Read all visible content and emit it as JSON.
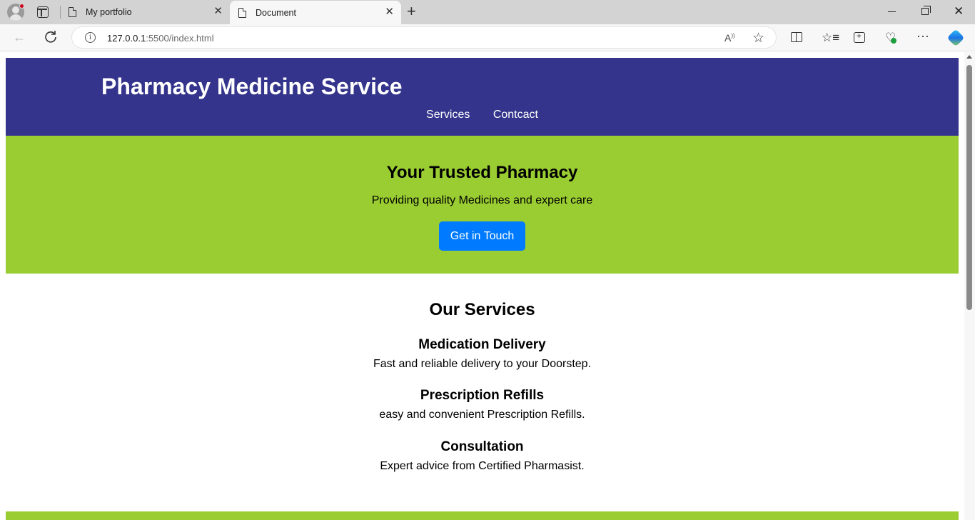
{
  "browser": {
    "tabs": [
      {
        "title": "My portfolio",
        "active": false
      },
      {
        "title": "Document",
        "active": true
      }
    ],
    "url_host": "127.0.0.1",
    "url_rest": ":5500/index.html",
    "icons": [
      "profile-icon",
      "tab-actions-icon",
      "document-icon",
      "close-icon",
      "new-tab-icon",
      "back-icon",
      "reload-icon",
      "info-icon",
      "read-aloud-icon",
      "favorite-star-icon",
      "split-screen-icon",
      "favorites-icon",
      "collections-icon",
      "browser-essentials-icon",
      "more-icon",
      "copilot-icon"
    ]
  },
  "site": {
    "title": "Pharmacy Medicine Service",
    "nav": [
      "Services",
      "Contcact"
    ],
    "hero": {
      "heading": "Your Trusted Pharmacy",
      "subtext": "Providing quality Medicines and expert care",
      "button": "Get in Touch"
    },
    "services": {
      "heading": "Our Services",
      "items": [
        {
          "title": "Medication Delivery",
          "desc": "Fast and reliable delivery to your Doorstep."
        },
        {
          "title": "Prescription Refills",
          "desc": "easy and convenient Prescription Refills."
        },
        {
          "title": "Consultation",
          "desc": "Expert advice from Certified Pharmasist."
        }
      ]
    }
  },
  "colors": {
    "header_bg": "#34348c",
    "hero_bg": "#9acd32",
    "button_bg": "#007bff"
  }
}
